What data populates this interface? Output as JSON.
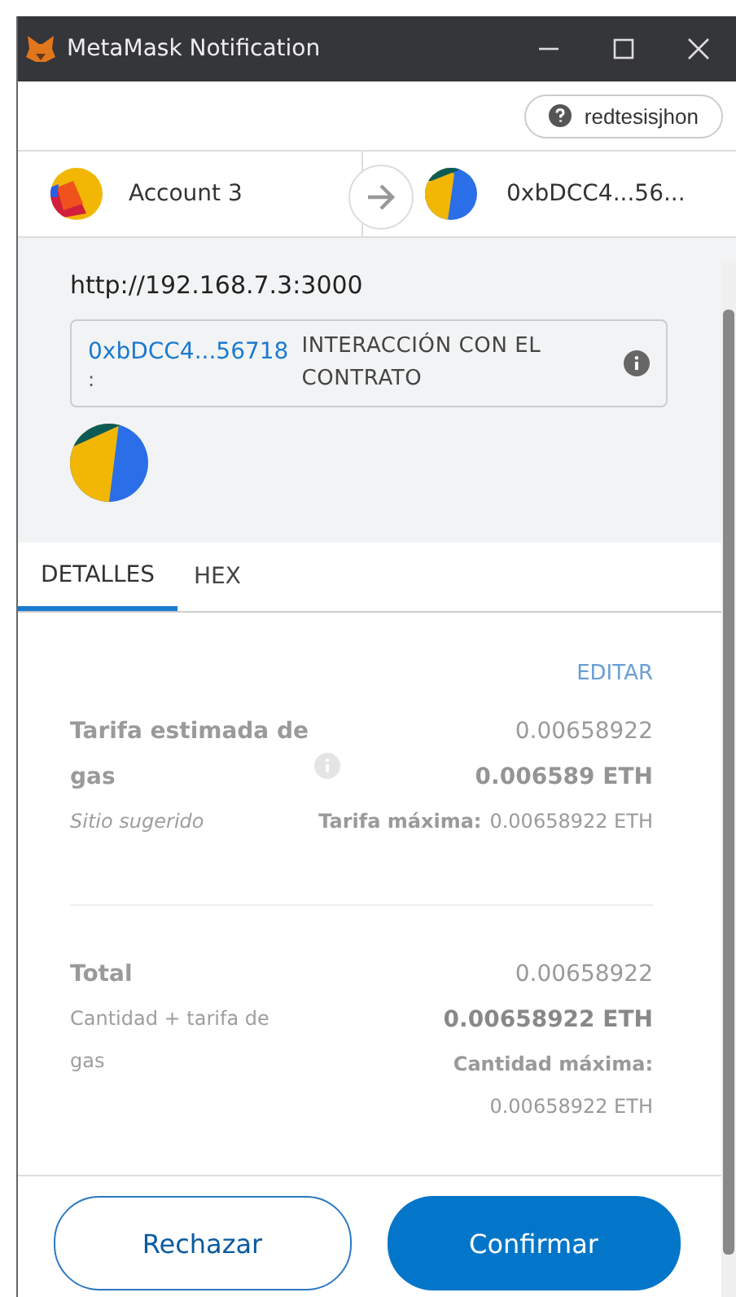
{
  "window": {
    "title": "MetaMask Notification"
  },
  "network": {
    "label": "redtesisjhon"
  },
  "accounts": {
    "from": "Account 3",
    "to": "0xbDCC4...56..."
  },
  "origin": "http://192.168.7.3:3000",
  "contract": {
    "address": "0xbDCC4...56718",
    "separator": ":",
    "action": "INTERACCIÓN CON EL CONTRATO"
  },
  "tabs": [
    {
      "label": "DETALLES",
      "selected": true
    },
    {
      "label": "HEX",
      "selected": false
    }
  ],
  "details": {
    "edit": "EDITAR",
    "gas": {
      "label": "Tarifa estimada de gas",
      "value": "0.00658922",
      "value_eth": "0.006589 ETH",
      "note": "Sitio sugerido",
      "max_label": "Tarifa máxima:",
      "max_value": "0.00658922 ETH"
    },
    "total": {
      "label": "Total",
      "value": "0.00658922",
      "value_eth": "0.00658922 ETH",
      "note": "Cantidad + tarifa de gas",
      "max_label": "Cantidad máxima:",
      "max_value": "0.00658922 ETH"
    }
  },
  "buttons": [
    {
      "label": "Rechazar",
      "kind": "secondary"
    },
    {
      "label": "Confirmar",
      "kind": "primary"
    }
  ]
}
